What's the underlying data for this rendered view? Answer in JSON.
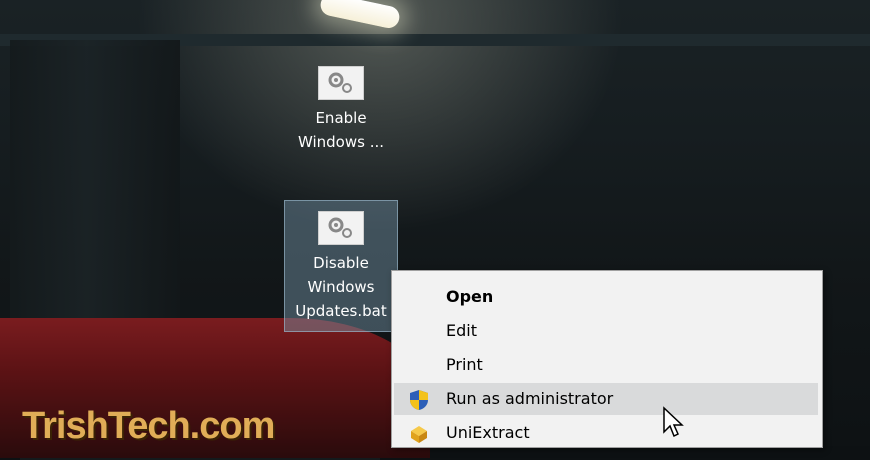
{
  "watermark": "TrishTech.com",
  "desktop": {
    "icons": [
      {
        "label_line1": "Enable",
        "label_line2": "Windows ..."
      },
      {
        "label_line1": "Disable",
        "label_line2": "Windows",
        "label_line3": "Updates.bat"
      }
    ]
  },
  "context_menu": {
    "items": [
      {
        "label": "Open",
        "icon": ""
      },
      {
        "label": "Edit",
        "icon": ""
      },
      {
        "label": "Print",
        "icon": ""
      },
      {
        "label": "Run as administrator",
        "icon": "uac-shield-icon"
      },
      {
        "label": "UniExtract",
        "icon": "uniextract-icon"
      }
    ]
  }
}
